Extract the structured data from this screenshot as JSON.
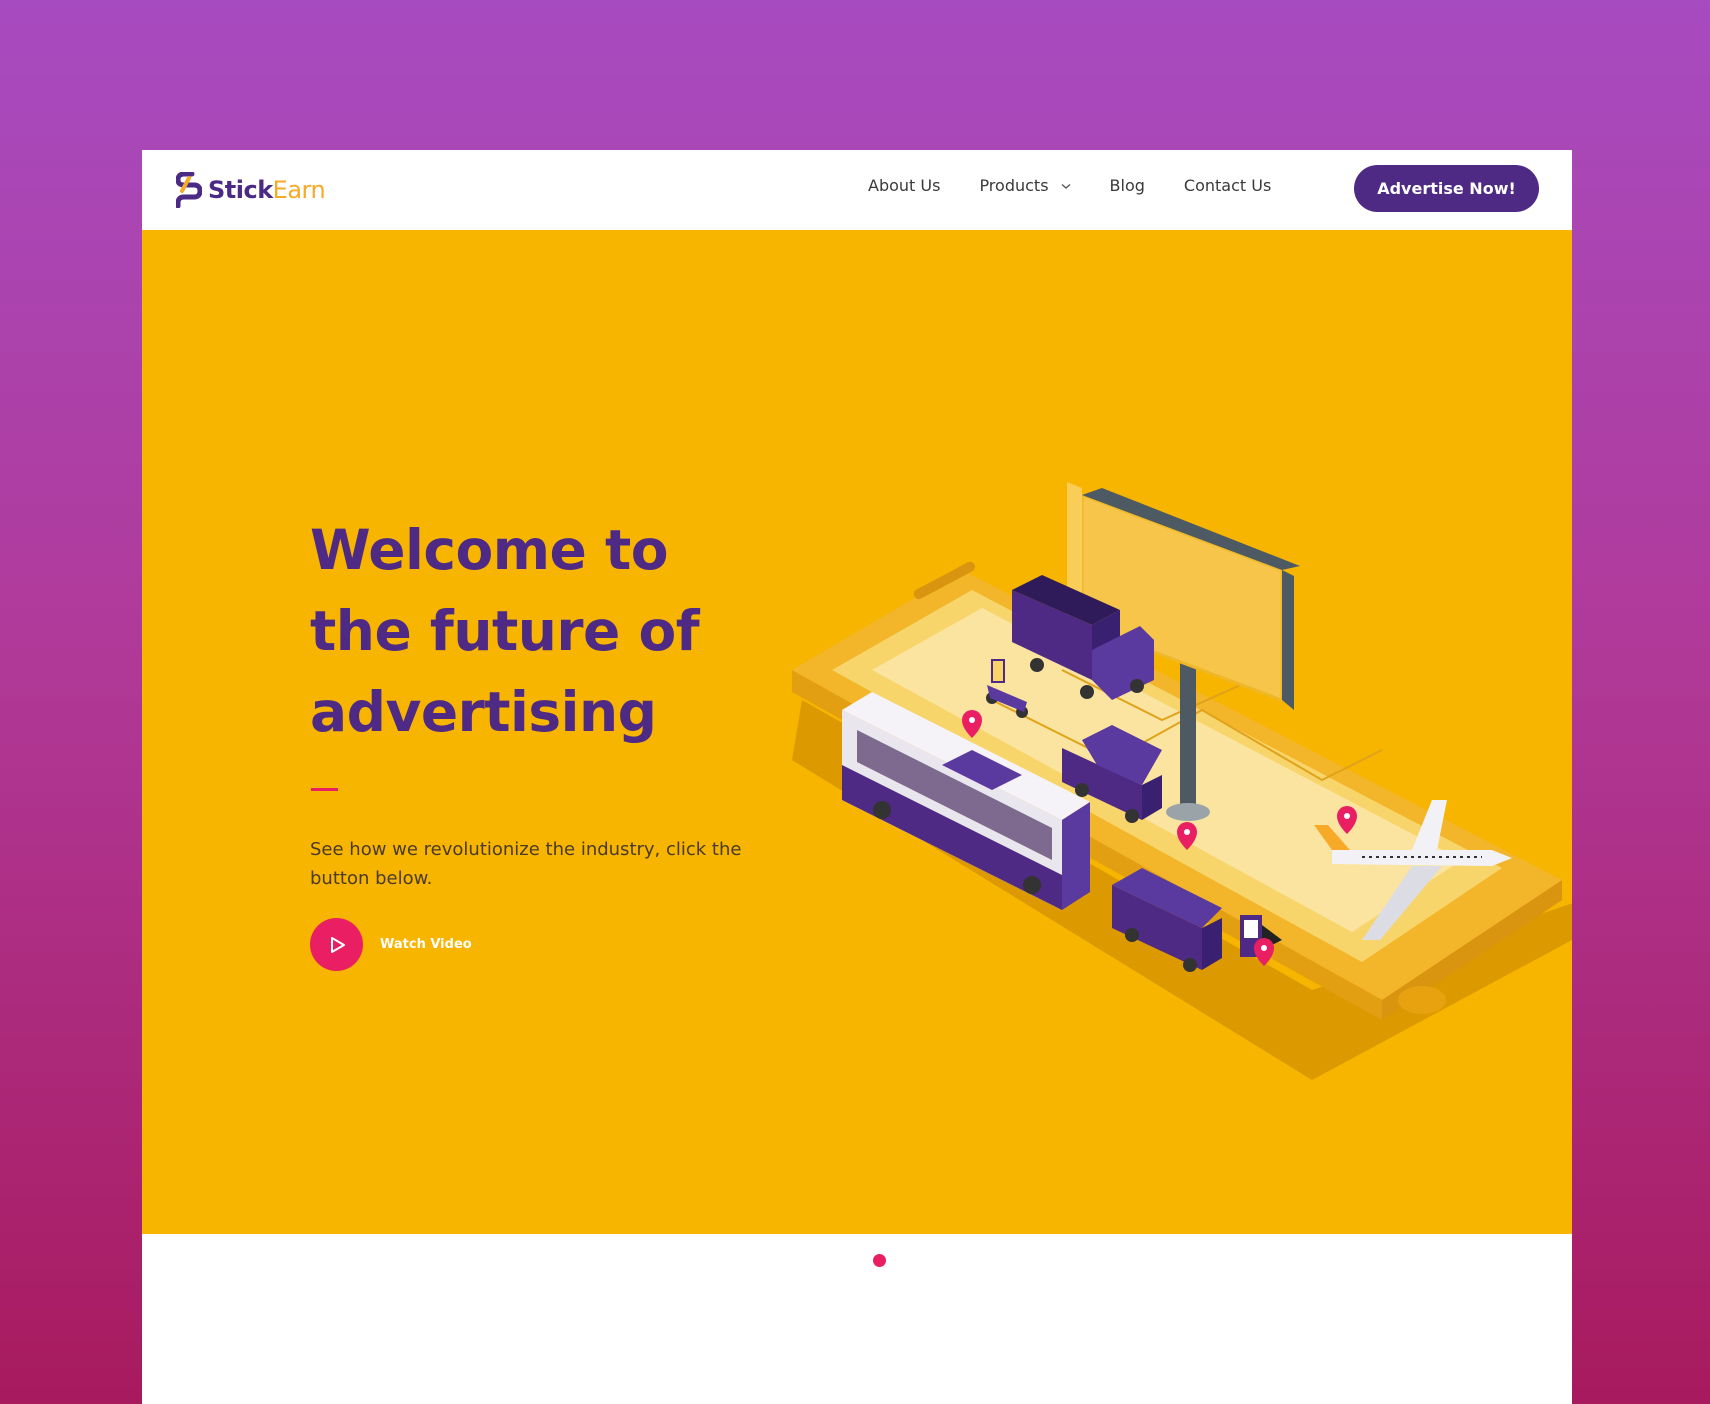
{
  "brand": {
    "name_part1": "Stick",
    "name_part2": "Earn",
    "colors": {
      "primary": "#4e2a84",
      "accent": "#f7a928",
      "hero_bg": "#f7b500",
      "pink": "#e91e63"
    }
  },
  "nav": {
    "items": [
      {
        "label": "About Us"
      },
      {
        "label": "Products",
        "icon": "chevron-down-icon"
      },
      {
        "label": "Blog"
      },
      {
        "label": "Contact Us"
      }
    ],
    "cta_label": "Advertise Now!"
  },
  "hero": {
    "title": "Welcome to the future of advertising",
    "subtitle": "See how we revolutionize the industry, click the button below.",
    "watch_label": "Watch Video",
    "play_icon": "play-icon"
  },
  "slider": {
    "count": 2,
    "active_index": 1,
    "colors": [
      "#ffffff",
      "#e91e63"
    ]
  }
}
